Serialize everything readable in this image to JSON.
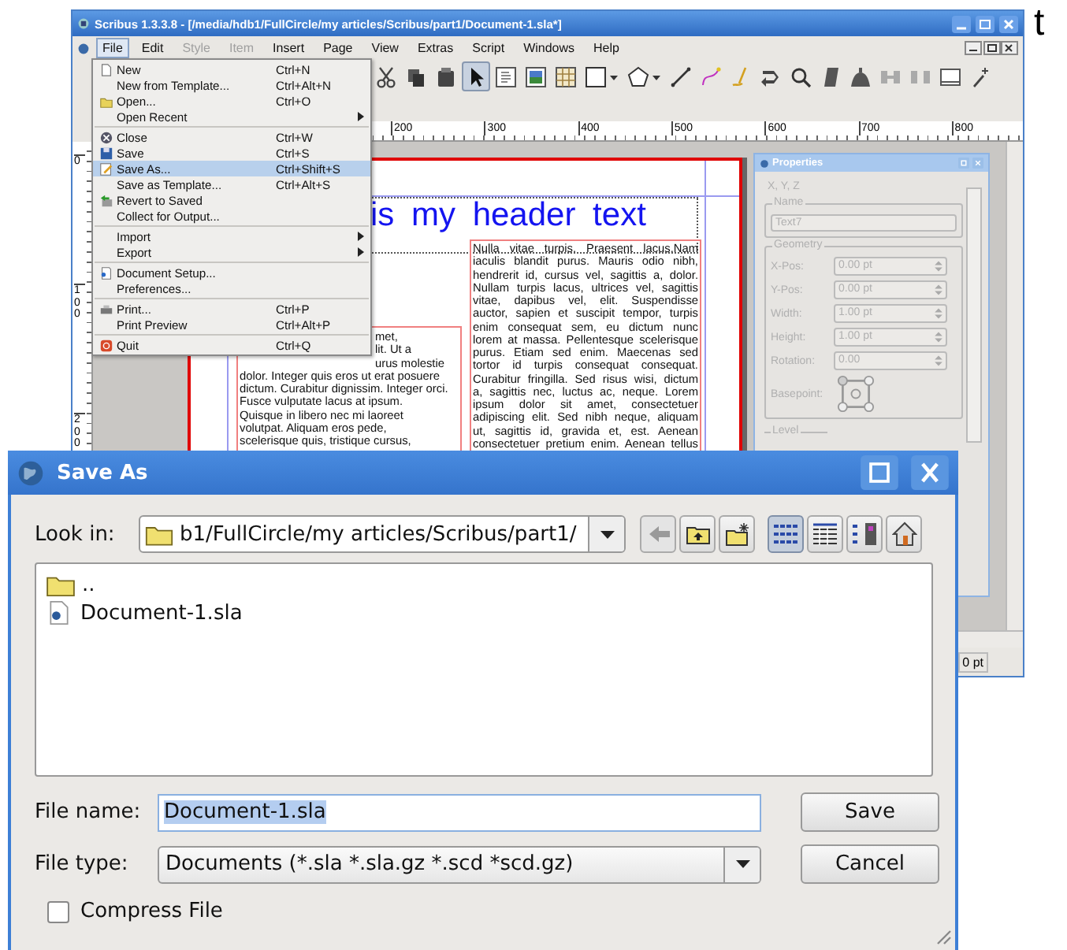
{
  "window": {
    "title": "Scribus 1.3.3.8 - [/media/hdb1/FullCircle/my articles/Scribus/part1/Document-1.sla*]"
  },
  "menubar": [
    {
      "label": "File",
      "selected": true,
      "disabled": false
    },
    {
      "label": "Edit",
      "selected": false,
      "disabled": false
    },
    {
      "label": "Style",
      "selected": false,
      "disabled": true
    },
    {
      "label": "Item",
      "selected": false,
      "disabled": true
    },
    {
      "label": "Insert",
      "selected": false,
      "disabled": false
    },
    {
      "label": "Page",
      "selected": false,
      "disabled": false
    },
    {
      "label": "View",
      "selected": false,
      "disabled": false
    },
    {
      "label": "Extras",
      "selected": false,
      "disabled": false
    },
    {
      "label": "Script",
      "selected": false,
      "disabled": false
    },
    {
      "label": "Windows",
      "selected": false,
      "disabled": false
    },
    {
      "label": "Help",
      "selected": false,
      "disabled": false
    }
  ],
  "file_menu": [
    {
      "kind": "item",
      "label": "New",
      "shortcut": "Ctrl+N",
      "selected": false,
      "submenu": false
    },
    {
      "kind": "item",
      "label": "New from Template...",
      "shortcut": "Ctrl+Alt+N",
      "selected": false,
      "submenu": false
    },
    {
      "kind": "item",
      "label": "Open...",
      "shortcut": "Ctrl+O",
      "selected": false,
      "submenu": false
    },
    {
      "kind": "item",
      "label": "Open Recent",
      "selected": false,
      "submenu": true
    },
    {
      "kind": "separator"
    },
    {
      "kind": "item",
      "label": "Close",
      "shortcut": "Ctrl+W",
      "selected": false,
      "submenu": false
    },
    {
      "kind": "item",
      "label": "Save",
      "shortcut": "Ctrl+S",
      "selected": false,
      "submenu": false
    },
    {
      "kind": "item",
      "label": "Save As...",
      "shortcut": "Ctrl+Shift+S",
      "selected": true,
      "submenu": false
    },
    {
      "kind": "item",
      "label": "Save as Template...",
      "shortcut": "Ctrl+Alt+S",
      "selected": false,
      "submenu": false
    },
    {
      "kind": "item",
      "label": "Revert to Saved",
      "selected": false,
      "submenu": false
    },
    {
      "kind": "item",
      "label": "Collect for Output...",
      "selected": false,
      "submenu": false
    },
    {
      "kind": "separator"
    },
    {
      "kind": "item",
      "label": "Import",
      "selected": false,
      "submenu": true
    },
    {
      "kind": "item",
      "label": "Export",
      "selected": false,
      "submenu": true
    },
    {
      "kind": "separator"
    },
    {
      "kind": "item",
      "label": "Document Setup...",
      "selected": false,
      "submenu": false
    },
    {
      "kind": "item",
      "label": "Preferences...",
      "selected": false,
      "submenu": false
    },
    {
      "kind": "separator"
    },
    {
      "kind": "item",
      "label": "Print...",
      "shortcut": "Ctrl+P",
      "selected": false,
      "submenu": false
    },
    {
      "kind": "item",
      "label": "Print Preview",
      "shortcut": "Ctrl+Alt+P",
      "selected": false,
      "submenu": false
    },
    {
      "kind": "separator"
    },
    {
      "kind": "item",
      "label": "Quit",
      "shortcut": "Ctrl+Q",
      "selected": false,
      "submenu": false
    }
  ],
  "toolbar": [
    {
      "selected": false
    },
    {
      "selected": false
    },
    {
      "selected": false
    },
    {
      "selected": true
    },
    {
      "selected": false
    },
    {
      "selected": false
    },
    {
      "selected": false
    },
    {
      "selected": false
    },
    {
      "selected": false
    },
    {
      "selected": false
    },
    {
      "selected": false
    },
    {
      "selected": false
    },
    {
      "selected": false
    },
    {
      "selected": false
    },
    {
      "selected": false
    },
    {
      "selected": false
    },
    {
      "selected": false
    },
    {
      "selected": false
    },
    {
      "selected": false
    },
    {
      "selected": false
    }
  ],
  "ruler": {
    "horizontal": [
      "200",
      "300",
      "400",
      "500",
      "600",
      "700",
      "800"
    ],
    "vertical": [
      "0",
      "100",
      "200"
    ]
  },
  "page": {
    "header": "is my header text",
    "left_column": [
      {
        "kind": "clipped",
        "text": "met,"
      },
      {
        "kind": "clipped",
        "text": "lit. Ut a"
      },
      {
        "kind": "clipped",
        "text": "urus molestie"
      },
      {
        "kind": "line",
        "text": "dolor. Integer quis eros ut erat posuere"
      },
      {
        "kind": "line",
        "text": "dictum. Curabitur dignissim. Integer orci."
      },
      {
        "kind": "line",
        "text": "Fusce vulputate lacus at ipsum."
      },
      {
        "kind": "line",
        "text": "Quisque in libero nec mi laoreet"
      },
      {
        "kind": "line",
        "text": "volutpat. Aliquam eros pede,"
      },
      {
        "kind": "line",
        "text": "scelerisque quis, tristique cursus,"
      }
    ],
    "right_column": [
      "Nulla vitae turpis. Praesent lacus.Nam",
      "iaculis blandit purus. Mauris odio nibh,",
      "hendrerit id, cursus vel, sagittis a, dolor.",
      "Nullam turpis lacus, ultrices vel, sagittis",
      "vitae, dapibus vel, elit. Suspendisse",
      "auctor, sapien et suscipit tempor, turpis",
      "enim consequat sem, eu dictum nunc",
      "lorem at massa. Pellentesque scelerisque",
      "purus. Etiam sed enim. Maecenas sed",
      "tortor id turpis consequat consequat.",
      "Curabitur fringilla. Sed risus wisi, dictum",
      "a, sagittis nec, luctus ac, neque. Lorem",
      "ipsum dolor sit amet, consectetuer",
      "adipiscing elit. Sed nibh neque, aliquam",
      "ut, sagittis id, gravida et, est. Aenean",
      "consectetuer pretium enim. Aenean tellus"
    ]
  },
  "properties": {
    "title": "Properties",
    "tab": "X, Y, Z",
    "name_group": "Name",
    "name_value": "Text7",
    "geometry_group": "Geometry",
    "fields": [
      {
        "label": "X-Pos:",
        "value": "0.00 pt"
      },
      {
        "label": "Y-Pos:",
        "value": "0.00 pt"
      },
      {
        "label": "Width:",
        "value": "1.00 pt"
      },
      {
        "label": "Height:",
        "value": "1.00 pt"
      },
      {
        "label": "Rotation:",
        "value": "0.00"
      }
    ],
    "basepoint_label": "Basepoint:",
    "level_group": "Level",
    "disabled": true
  },
  "status_bar": {
    "zoom_value": "0 pt"
  },
  "dialog": {
    "title": "Save As",
    "look_in_label": "Look in:",
    "look_in_value": "b1/FullCircle/my articles/Scribus/part1/",
    "nav_buttons": [
      {
        "disabled": true
      },
      {
        "disabled": false
      },
      {
        "disabled": false
      }
    ],
    "view_buttons": [
      {
        "selected": true
      },
      {
        "selected": false
      },
      {
        "selected": false
      }
    ],
    "files": [
      {
        "kind": "folder",
        "name": ".."
      },
      {
        "kind": "file",
        "name": "Document-1.sla"
      }
    ],
    "file_name_label": "File name:",
    "file_name": "Document-1.sla",
    "file_name_selected": true,
    "file_type_label": "File type:",
    "file_type": "Documents (*.sla *.sla.gz *.scd *scd.gz)",
    "save_button": "Save",
    "cancel_button": "Cancel",
    "compress": {
      "label": "Compress File",
      "checked": false
    }
  },
  "edge_text": "t"
}
